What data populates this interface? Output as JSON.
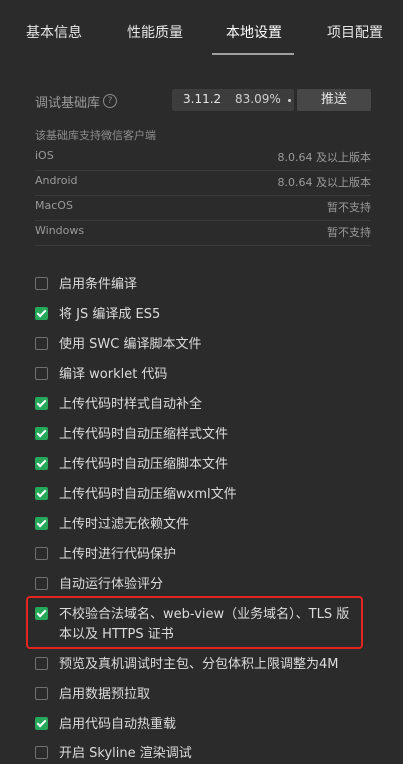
{
  "tabs": [
    "基本信息",
    "性能质量",
    "本地设置",
    "项目配置"
  ],
  "active_tab": "本地设置",
  "base_lib": {
    "label": "调试基础库",
    "help_icon": "question-circle-icon",
    "version": "3.11.2",
    "percent": "83.09%",
    "push_label": "推送"
  },
  "support": {
    "caption": "该基础库支持微信客户端",
    "rows": [
      {
        "name": "iOS",
        "value": "8.0.64 及以上版本"
      },
      {
        "name": "Android",
        "value": "8.0.64 及以上版本"
      },
      {
        "name": "MacOS",
        "value": "暂不支持"
      },
      {
        "name": "Windows",
        "value": "暂不支持"
      }
    ]
  },
  "options": [
    {
      "label": "启用条件编译",
      "checked": false
    },
    {
      "label": "将 JS 编译成 ES5",
      "checked": true
    },
    {
      "label": "使用 SWC 编译脚本文件",
      "checked": false
    },
    {
      "label": "编译 worklet 代码",
      "checked": false
    },
    {
      "label": "上传代码时样式自动补全",
      "checked": true
    },
    {
      "label": "上传代码时自动压缩样式文件",
      "checked": true
    },
    {
      "label": "上传代码时自动压缩脚本文件",
      "checked": true
    },
    {
      "label": "上传代码时自动压缩wxml文件",
      "checked": true
    },
    {
      "label": "上传时过滤无依赖文件",
      "checked": true
    },
    {
      "label": "上传时进行代码保护",
      "checked": false
    },
    {
      "label": "自动运行体验评分",
      "checked": false
    },
    {
      "label": "不校验合法域名、web-view（业务域名）、TLS 版本以及 HTTPS 证书",
      "checked": true
    },
    {
      "label": "预览及真机调试时主包、分包体积上限调整为4M",
      "checked": false
    },
    {
      "label": "启用数据预拉取",
      "checked": false
    },
    {
      "label": "启用代码自动热重载",
      "checked": true
    },
    {
      "label": "开启 Skyline 渲染调试",
      "checked": false
    }
  ],
  "colors": {
    "highlight": "#e0261f",
    "checked": "#25a85a",
    "background": "#2b2b2b"
  }
}
